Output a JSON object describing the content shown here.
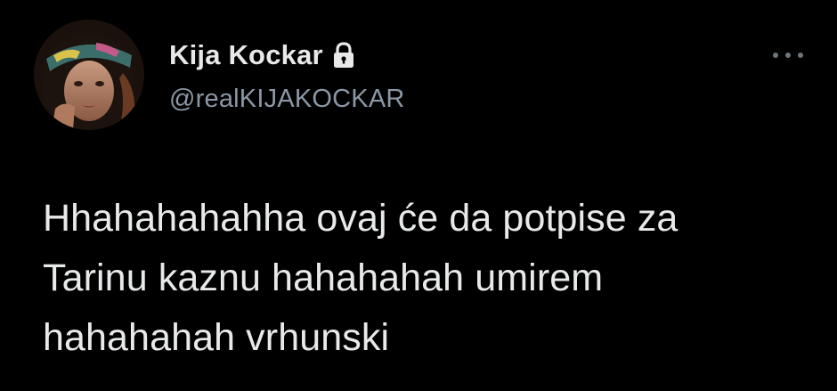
{
  "tweet": {
    "author": {
      "display_name": "Kija Kockar",
      "handle": "@realKIJAKOCKAR",
      "verified_icon": "lock-icon",
      "avatar_icon": "avatar"
    },
    "text": "Hhahahahahha ovaj će da potpise za\nTarinu kaznu hahahahah umirem\nhahahahah vrhunski",
    "more_icon": "more-options-icon"
  },
  "colors": {
    "background": "#000000",
    "name": "#e8e8e8",
    "handle": "#8b98a5",
    "text": "#e7e9ea",
    "more_dots": "#6e767d"
  }
}
